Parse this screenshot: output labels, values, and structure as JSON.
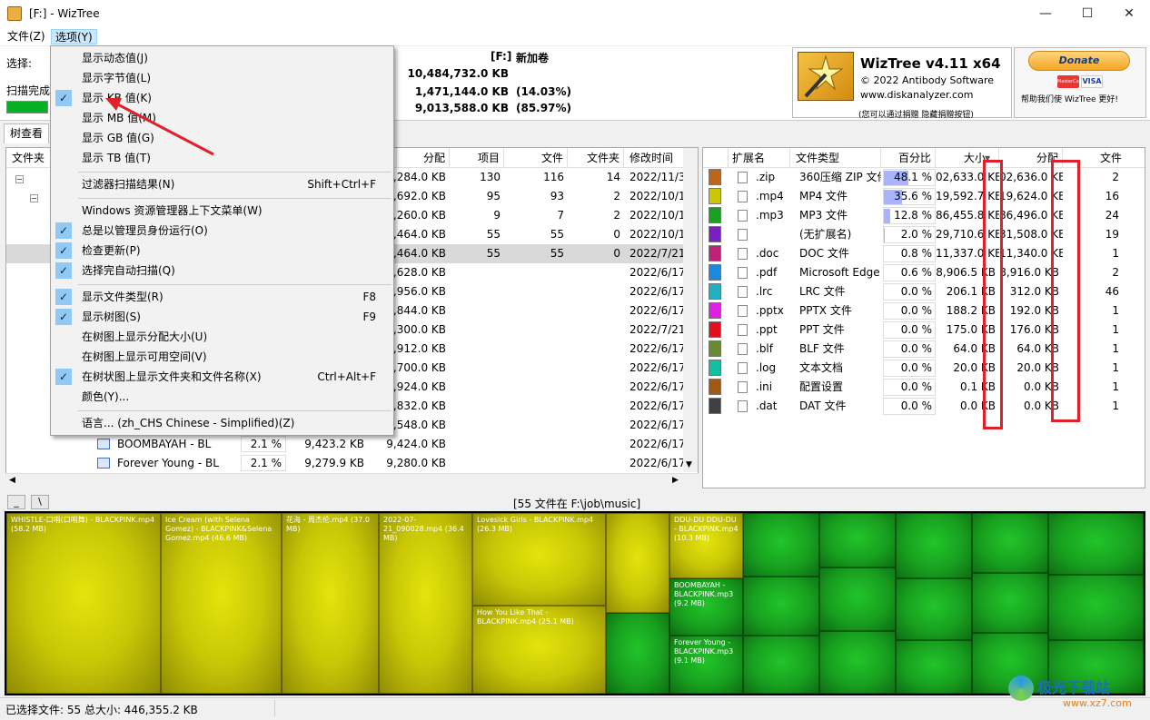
{
  "window": {
    "title": "[F:]  - WizTree",
    "minimize_glyph": "—",
    "maximize_glyph": "☐",
    "close_glyph": "✕"
  },
  "menu": {
    "file": "文件(Z)",
    "options": "选项(Y)"
  },
  "top": {
    "select_label": "选择:",
    "scan_label": "扫描完成",
    "drive": "[F:]",
    "volume": "新加卷",
    "total": "10,484,732.0 KB",
    "used": "1,471,144.0 KB",
    "used_pct": "(14.03%)",
    "free": "9,013,588.0 KB",
    "free_pct": "(85.97%)"
  },
  "brand": {
    "name": "WizTree v4.11 x64",
    "copyright": "© 2022 Antibody Software",
    "site": "www.diskanalyzer.com",
    "note": "(您可以通过捐赠 隐藏捐赠按钮)",
    "donate": "Donate",
    "card1": "MasterCard",
    "card2": "VISA",
    "help": "帮助我们使 WizTree 更好!"
  },
  "tab": "树查看",
  "tree": {
    "headers": {
      "folder": "文件夹",
      "alloc": "分配",
      "items": "项目",
      "files": "文件",
      "folders": "文件夹",
      "modified": "修改时间"
    },
    "rows": [
      {
        "alloc": "61,284.0 KB",
        "items": "130",
        "files": "116",
        "folders": "14",
        "mod": "2022/11/30"
      },
      {
        "alloc": "59,692.0 KB",
        "items": "95",
        "files": "93",
        "folders": "2",
        "mod": "2022/10/13"
      },
      {
        "alloc": "53,260.0 KB",
        "items": "9",
        "files": "7",
        "folders": "2",
        "mod": "2022/10/13"
      },
      {
        "alloc": "46,464.0 KB",
        "items": "55",
        "files": "55",
        "folders": "0",
        "mod": "2022/10/13"
      },
      {
        "alloc": "46,464.0 KB",
        "items": "55",
        "files": "55",
        "folders": "0",
        "mod": "2022/7/21"
      },
      {
        "alloc": "59,628.0 KB",
        "items": "",
        "files": "",
        "folders": "",
        "mod": "2022/6/17"
      },
      {
        "alloc": "37,956.0 KB",
        "items": "",
        "files": "",
        "folders": "",
        "mod": "2022/6/17"
      },
      {
        "alloc": "37,844.0 KB",
        "items": "",
        "files": "",
        "folders": "",
        "mod": "2022/6/17"
      },
      {
        "alloc": "37,300.0 KB",
        "items": "",
        "files": "",
        "folders": "",
        "mod": "2022/7/21"
      },
      {
        "alloc": "26,912.0 KB",
        "items": "",
        "files": "",
        "folders": "",
        "mod": "2022/6/17"
      },
      {
        "alloc": "25,700.0 KB",
        "items": "",
        "files": "",
        "folders": "",
        "mod": "2022/6/17"
      },
      {
        "alloc": "13,924.0 KB",
        "items": "",
        "files": "",
        "folders": "",
        "mod": "2022/6/17"
      },
      {
        "alloc": "10,832.0 KB",
        "items": "",
        "files": "",
        "folders": "",
        "mod": "2022/6/17"
      },
      {
        "alloc": "10,548.0 KB",
        "items": "",
        "files": "",
        "folders": "",
        "mod": "2022/6/17"
      },
      {
        "name": "BOOMBAYAH - BL",
        "pct": "2.1 %",
        "size": "9,423.2 KB",
        "alloc": "9,424.0 KB",
        "items": "",
        "files": "",
        "folders": "",
        "mod": "2022/6/17"
      },
      {
        "name": "Forever Young - BL",
        "pct": "2.1 %",
        "size": "9,279.9 KB",
        "alloc": "9,280.0 KB",
        "items": "",
        "files": "",
        "folders": "",
        "mod": "2022/6/17"
      }
    ]
  },
  "ext": {
    "headers": {
      "ext": "扩展名",
      "type": "文件类型",
      "pct": "百分比",
      "size": "大小",
      "alloc": "分配",
      "files": "文件"
    },
    "rows": [
      {
        "color": "#c0641a",
        "ext": ".zip",
        "type": "360压缩 ZIP 文件",
        "pct": "48.1 %",
        "bar": 0.481,
        "size": "02,633.0 KB",
        "alloc": "02,636.0 KB",
        "files": "2"
      },
      {
        "color": "#c9c706",
        "ext": ".mp4",
        "type": "MP4 文件",
        "pct": "35.6 %",
        "bar": 0.356,
        "size": "19,592.7 KB",
        "alloc": "19,624.0 KB",
        "files": "16"
      },
      {
        "color": "#18a01f",
        "ext": ".mp3",
        "type": "MP3 文件",
        "pct": "12.8 %",
        "bar": 0.128,
        "size": "86,455.8 KB",
        "alloc": "86,496.0 KB",
        "files": "24"
      },
      {
        "color": "#7a20c0",
        "ext": "",
        "type": "(无扩展名)",
        "pct": "2.0 %",
        "bar": 0.02,
        "size": "29,710.6 KB",
        "alloc": "31,508.0 KB",
        "files": "19"
      },
      {
        "color": "#c0207a",
        "ext": ".doc",
        "type": "DOC 文件",
        "pct": "0.8 %",
        "bar": 0.008,
        "size": "11,337.0 KB",
        "alloc": "11,340.0 KB",
        "files": "1"
      },
      {
        "color": "#1a8ae0",
        "ext": ".pdf",
        "type": "Microsoft Edge P",
        "pct": "0.6 %",
        "bar": 0.006,
        "size": "8,906.5 KB",
        "alloc": "8,916.0 KB",
        "files": "2"
      },
      {
        "color": "#20b0c0",
        "ext": ".lrc",
        "type": "LRC 文件",
        "pct": "0.0 %",
        "bar": 0,
        "size": "206.1 KB",
        "alloc": "312.0 KB",
        "files": "46"
      },
      {
        "color": "#e020e0",
        "ext": ".pptx",
        "type": "PPTX 文件",
        "pct": "0.0 %",
        "bar": 0,
        "size": "188.2 KB",
        "alloc": "192.0 KB",
        "files": "1"
      },
      {
        "color": "#e01020",
        "ext": ".ppt",
        "type": "PPT 文件",
        "pct": "0.0 %",
        "bar": 0,
        "size": "175.0 KB",
        "alloc": "176.0 KB",
        "files": "1"
      },
      {
        "color": "#6a8a30",
        "ext": ".blf",
        "type": "BLF 文件",
        "pct": "0.0 %",
        "bar": 0,
        "size": "64.0 KB",
        "alloc": "64.0 KB",
        "files": "1"
      },
      {
        "color": "#10c0a0",
        "ext": ".log",
        "type": "文本文档",
        "pct": "0.0 %",
        "bar": 0,
        "size": "20.0 KB",
        "alloc": "20.0 KB",
        "files": "1"
      },
      {
        "color": "#a05a10",
        "ext": ".ini",
        "type": "配置设置",
        "pct": "0.0 %",
        "bar": 0,
        "size": "0.1 KB",
        "alloc": "0.0 KB",
        "files": "1"
      },
      {
        "color": "#404040",
        "ext": ".dat",
        "type": "DAT 文件",
        "pct": "0.0 %",
        "bar": 0,
        "size": "0.0 KB",
        "alloc": "0.0 KB",
        "files": "1"
      }
    ]
  },
  "dropdown": {
    "items": [
      {
        "label": "显示动态值(J)",
        "checked": false,
        "shortcut": ""
      },
      {
        "label": "显示字节值(L)",
        "checked": false,
        "shortcut": ""
      },
      {
        "label": "显示 KB 值(K)",
        "checked": true,
        "shortcut": ""
      },
      {
        "label": "显示 MB 值(M)",
        "checked": false,
        "shortcut": ""
      },
      {
        "label": "显示 GB 值(G)",
        "checked": false,
        "shortcut": ""
      },
      {
        "label": "显示 TB 值(T)",
        "checked": false,
        "shortcut": ""
      },
      {
        "label": "过滤器扫描结果(N)",
        "checked": false,
        "shortcut": "Shift+Ctrl+F"
      },
      {
        "label": "Windows 资源管理器上下文菜单(W)",
        "checked": false,
        "shortcut": ""
      },
      {
        "label": "总是以管理员身份运行(O)",
        "checked": true,
        "shortcut": ""
      },
      {
        "label": "检查更新(P)",
        "checked": true,
        "shortcut": ""
      },
      {
        "label": "选择完自动扫描(Q)",
        "checked": true,
        "shortcut": ""
      },
      {
        "label": "显示文件类型(R)",
        "checked": true,
        "shortcut": "F8"
      },
      {
        "label": "显示树图(S)",
        "checked": true,
        "shortcut": "F9"
      },
      {
        "label": "在树图上显示分配大小(U)",
        "checked": false,
        "shortcut": ""
      },
      {
        "label": "在树图上显示可用空间(V)",
        "checked": false,
        "shortcut": ""
      },
      {
        "label": "在树状图上显示文件夹和文件名称(X)",
        "checked": true,
        "shortcut": "Ctrl+Alt+F"
      },
      {
        "label": "颜色(Y)...",
        "checked": false,
        "shortcut": ""
      },
      {
        "label": "语言... (zh_CHS Chinese - Simplified)(Z)",
        "checked": false,
        "shortcut": ""
      }
    ]
  },
  "pathbar": {
    "btn1": "_",
    "btn2": "\\",
    "path": "[55 文件在 F:\\job\\music]"
  },
  "treemap": {
    "tiles": [
      {
        "label": "WHISTLE-口哨(口哨舞) - BLACKPINK.mp4 (58.2 MB)"
      },
      {
        "label": "Ice Cream (with Selena Gomez) - BLACKPINK&Selena Gomez.mp4 (46.6 MB)"
      },
      {
        "label": "花海 - 周杰伦.mp4 (37.0 MB)"
      },
      {
        "label": "2022-07-21_090028.mp4 (36.4 MB)"
      },
      {
        "label": "Lovesick Girls - BLACKPINK.mp4 (26.3 MB)"
      },
      {
        "label": "How You Like That - BLACKPINK.mp4 (25.1 MB)"
      },
      {
        "label": "DDU-DU DDU-DU - BLACKPINK.mp4 (10.3 MB)"
      },
      {
        "label": "BOOMBAYAH - BLACKPINK.mp3 (9.2 MB)"
      },
      {
        "label": "Forever Young - BLACKPINK.mp3 (9.1 MB)"
      }
    ]
  },
  "status": {
    "selected": "已选择文件: 55  总大小: 446,355.2 KB"
  },
  "watermark": {
    "text": "极光下载站",
    "url": "www.xz7.com"
  }
}
